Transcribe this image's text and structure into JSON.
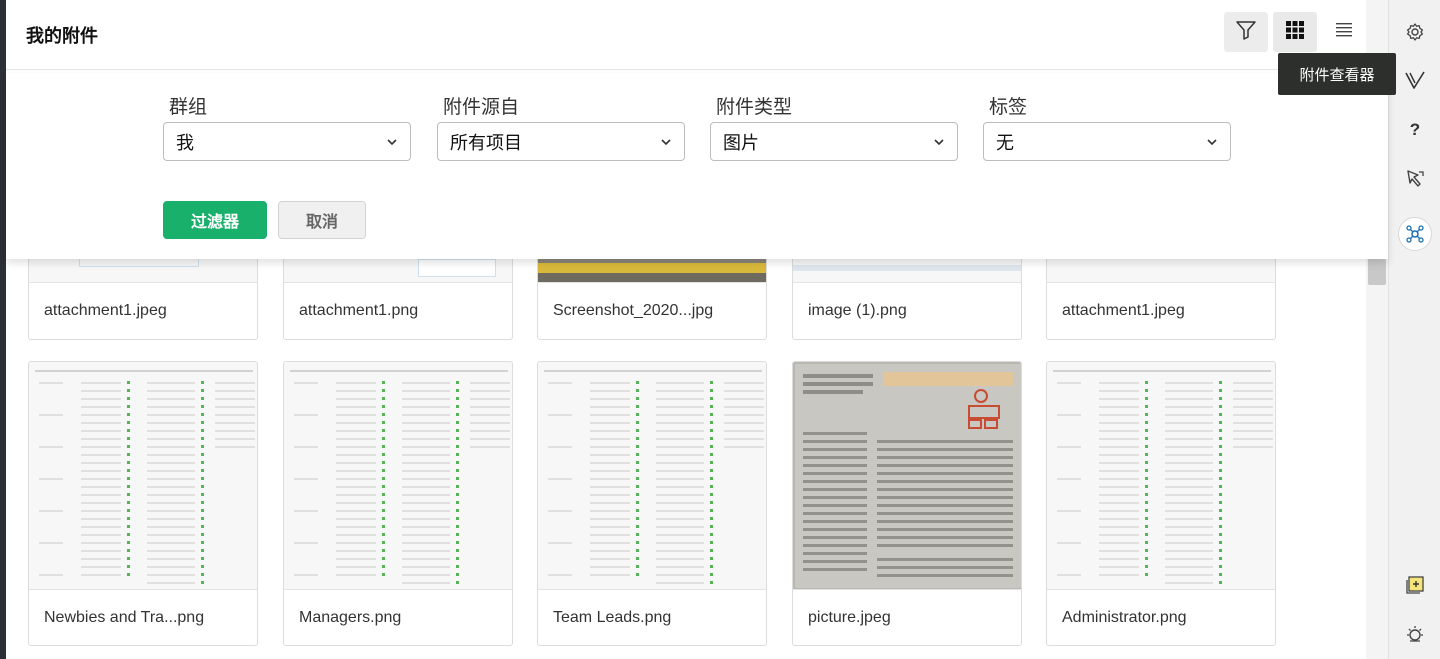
{
  "header": {
    "title": "我的附件",
    "tooltip": "附件查看器",
    "view_icons": [
      "filter-icon",
      "grid-view-icon",
      "list-view-icon"
    ]
  },
  "filter": {
    "fields": [
      {
        "label": "群组",
        "value": "我"
      },
      {
        "label": "附件源自",
        "value": "所有项目"
      },
      {
        "label": "附件类型",
        "value": "图片"
      },
      {
        "label": "标签",
        "value": "无"
      }
    ],
    "apply_label": "过滤器",
    "cancel_label": "取消"
  },
  "attachments_row1": [
    {
      "name": "attachment1.jpeg"
    },
    {
      "name": "attachment1.png"
    },
    {
      "name": "Screenshot_2020...jpg"
    },
    {
      "name": "image (1).png"
    },
    {
      "name": "attachment1.jpeg"
    }
  ],
  "attachments_row2": [
    {
      "name": "Newbies and Tra...png",
      "thumb": "table-screenshot"
    },
    {
      "name": "Managers.png",
      "thumb": "table-screenshot"
    },
    {
      "name": "Team Leads.png",
      "thumb": "table-screenshot"
    },
    {
      "name": "picture.jpeg",
      "thumb": "newspaper-photo"
    },
    {
      "name": "Administrator.png",
      "thumb": "table-screenshot"
    }
  ],
  "rail": {
    "icons": [
      "settings-icon",
      "vertex-logo-icon",
      "help-icon",
      "tour-icon",
      "network-icon",
      "add-note-icon",
      "theme-icon"
    ],
    "help_label": "?"
  },
  "colors": {
    "accent_green": "#19b06b",
    "tooltip_bg": "#2d2f2c"
  }
}
